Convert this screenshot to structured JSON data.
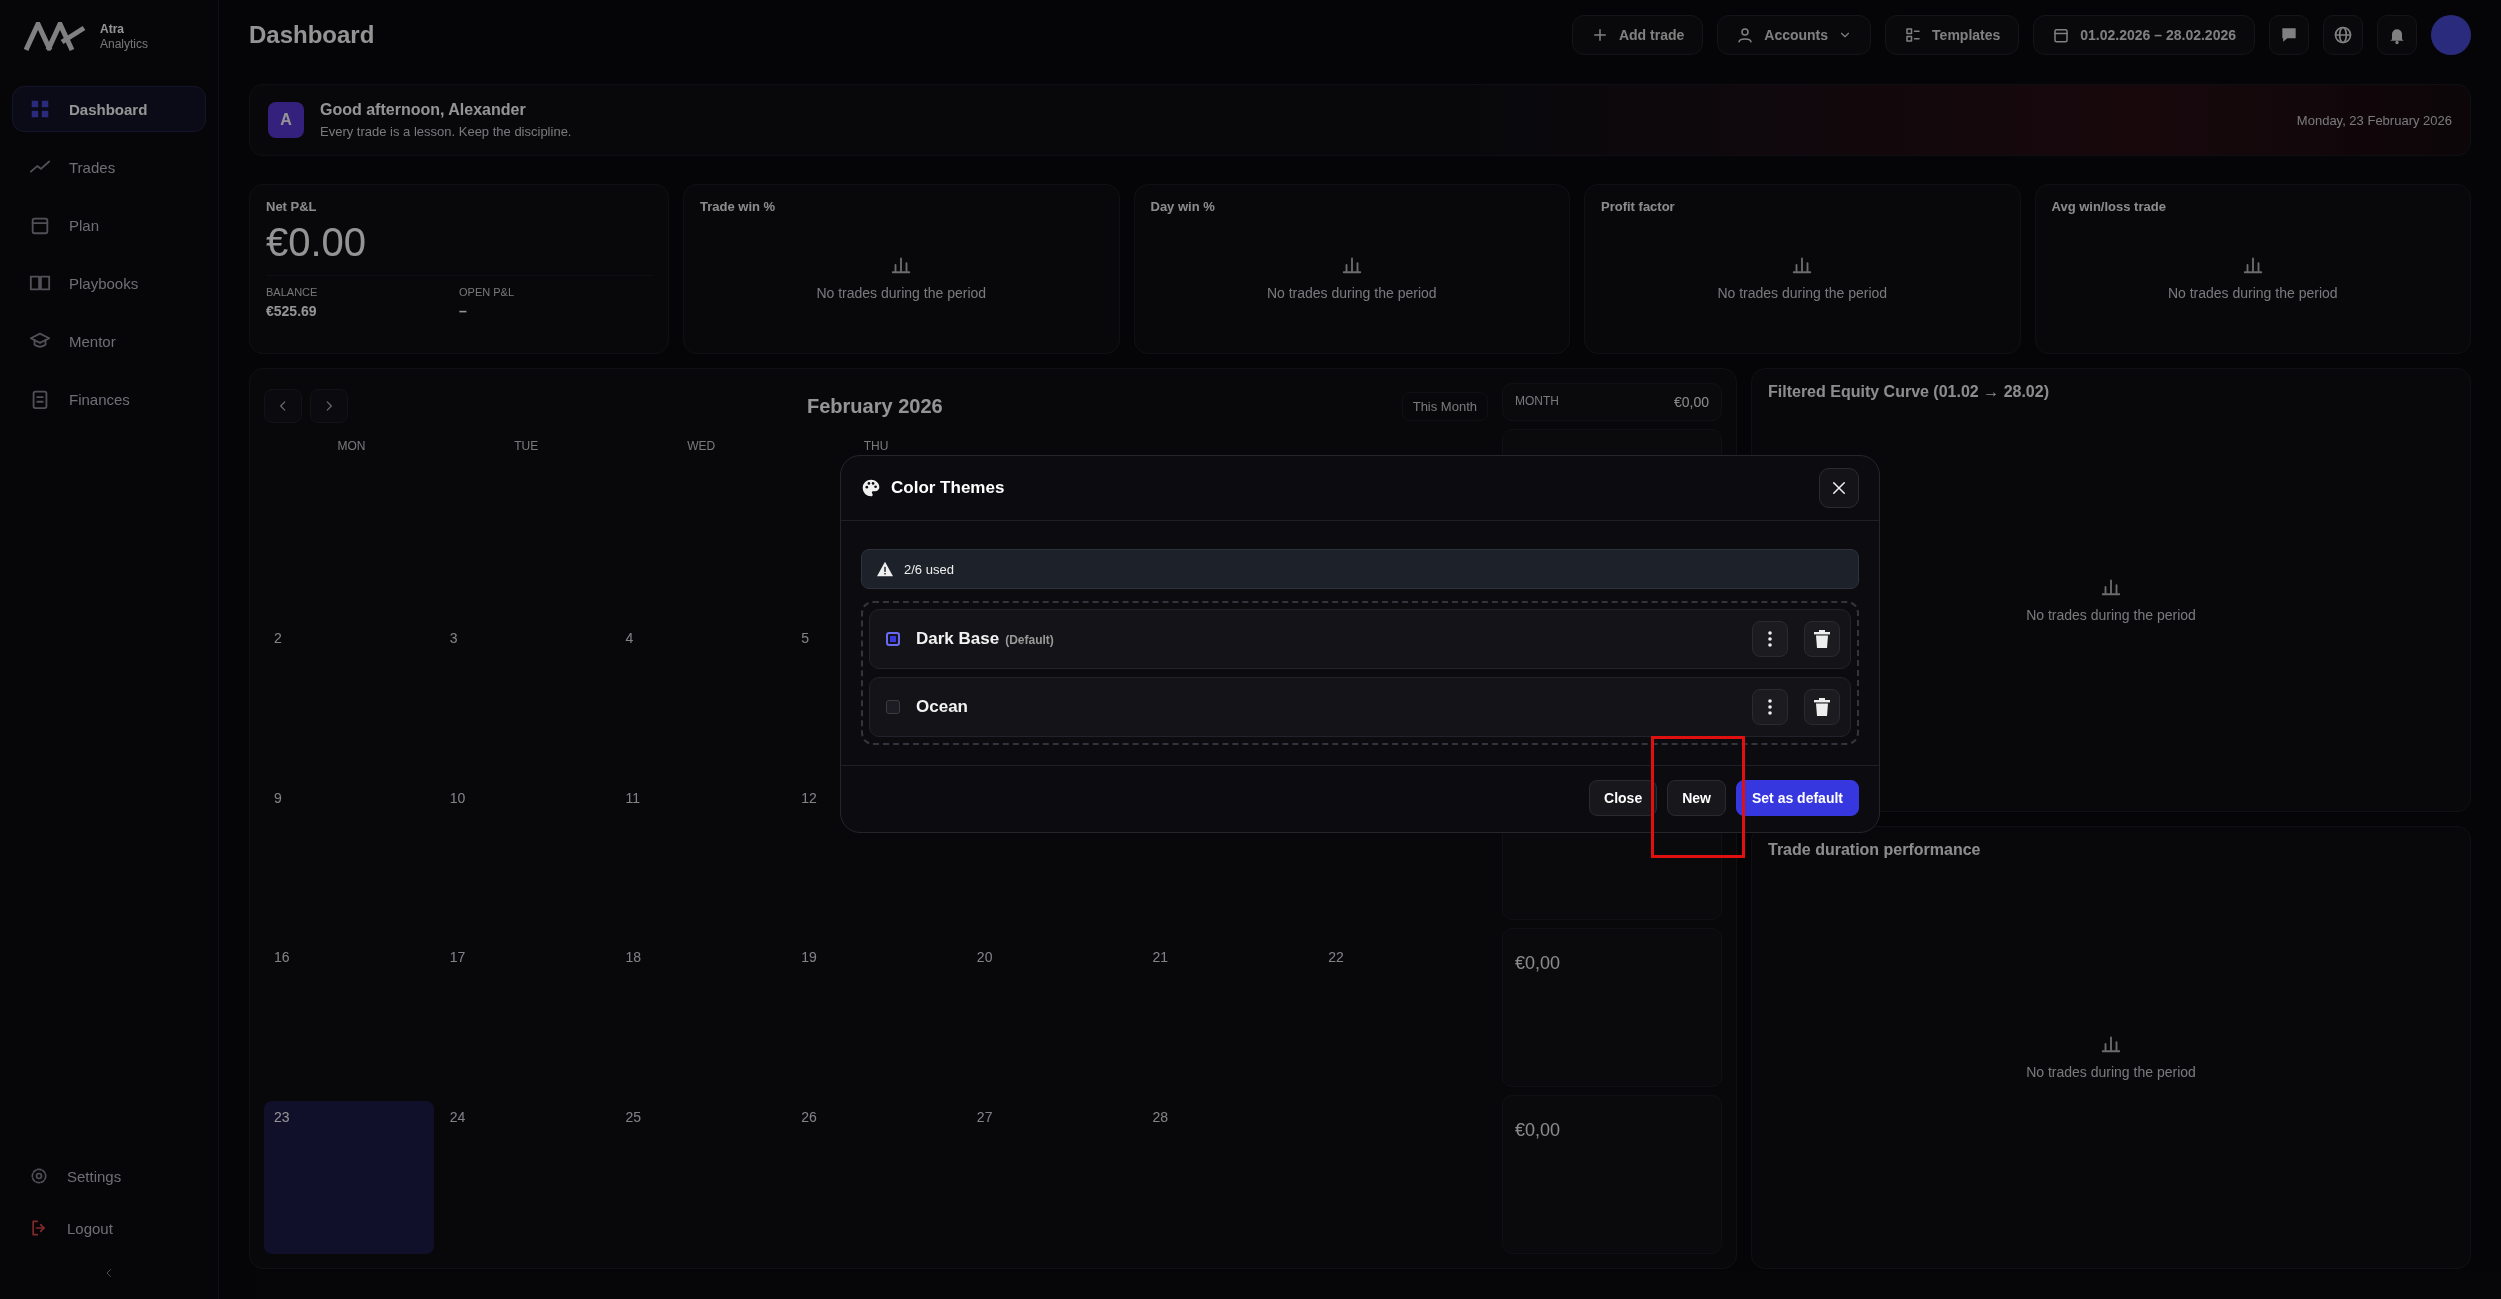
{
  "sidebar": {
    "brand": {
      "name": "Atra",
      "subtitle": "Analytics"
    },
    "items": [
      {
        "kind": "dashboard",
        "label": "Dashboard",
        "selected": true
      },
      {
        "kind": "trades",
        "label": "Trades",
        "selected": false
      },
      {
        "kind": "plan",
        "label": "Plan",
        "selected": false
      },
      {
        "kind": "playbooks",
        "label": "Playbooks",
        "selected": false
      },
      {
        "kind": "mentor",
        "label": "Mentor",
        "selected": false
      },
      {
        "kind": "finances",
        "label": "Finances",
        "selected": false
      }
    ],
    "bottom_items": [
      {
        "kind": "settings",
        "label": "Settings"
      },
      {
        "kind": "logout",
        "label": "Logout"
      }
    ]
  },
  "header": {
    "title": "Dashboard",
    "actions": [
      {
        "kind": "add",
        "label": "Add trade"
      },
      {
        "kind": "accounts",
        "label": "Accounts"
      },
      {
        "kind": "templates",
        "label": "Templates"
      },
      {
        "kind": "date",
        "label": "01.02.2026 – 28.02.2026"
      }
    ],
    "icon_buttons": [
      {
        "kind": "chat"
      },
      {
        "kind": "globe"
      },
      {
        "kind": "bell"
      }
    ]
  },
  "greeting": {
    "initial": "A",
    "title": "Good afternoon, Alexander",
    "subtitle": "Every trade is a lesson. Keep the discipline.",
    "date": "Monday, 23 February 2026"
  },
  "kpis": [
    {
      "kind": "pnl",
      "title": "Net P&L",
      "value": "€0.00",
      "balance_label": "BALANCE",
      "balance": "€525.69",
      "open_label": "OPEN P&L",
      "open": "–"
    },
    {
      "kind": "empty",
      "title": "Trade win %",
      "message": "No trades during the period"
    },
    {
      "kind": "empty",
      "title": "Day win %",
      "message": "No trades during the period"
    },
    {
      "kind": "empty",
      "title": "Profit factor",
      "message": "No trades during the period"
    },
    {
      "kind": "empty",
      "title": "Avg win/loss trade",
      "message": "No trades during the period"
    }
  ],
  "calendar": {
    "title": "February 2026",
    "range_button": "This Month",
    "weekdays": [
      "MON",
      "TUE",
      "WED",
      "THU"
    ],
    "weeks": [
      [
        {
          "day": "2",
          "today": false
        },
        {
          "day": "3",
          "today": false
        },
        {
          "day": "4",
          "today": false
        },
        {
          "day": "5",
          "today": false
        }
      ],
      [
        {
          "day": "9",
          "today": false
        },
        {
          "day": "10",
          "today": false
        },
        {
          "day": "11",
          "today": false
        },
        {
          "day": "12",
          "today": false
        }
      ],
      [
        {
          "day": "16",
          "today": false
        },
        {
          "day": "17",
          "today": false
        },
        {
          "day": "18",
          "today": false
        },
        {
          "day": "19",
          "today": false
        },
        {
          "day": "20",
          "today": false
        },
        {
          "day": "21",
          "today": false
        },
        {
          "day": "22",
          "today": false
        }
      ],
      [
        {
          "day": "23",
          "today": true
        },
        {
          "day": "24",
          "today": false
        },
        {
          "day": "25",
          "today": false
        },
        {
          "day": "26",
          "today": false
        },
        {
          "day": "27",
          "today": false
        },
        {
          "day": "28",
          "today": false
        }
      ]
    ],
    "month_summary": {
      "label": "MONTH",
      "value": "€0,00"
    },
    "week_summaries": [
      {
        "value": "€0,00"
      },
      {
        "value": "€0,00"
      }
    ]
  },
  "panels": [
    {
      "title": "Filtered Equity Curve (01.02 → 28.02)",
      "message": "No trades during the period"
    },
    {
      "title": "Trade duration performance",
      "message": "No trades during the period"
    }
  ],
  "modal": {
    "title": "Color Themes",
    "usage": "2/6 used",
    "themes": [
      {
        "name": "Dark Base",
        "tag": "(Default)",
        "checked": true
      },
      {
        "name": "Ocean",
        "checked": false
      }
    ],
    "buttons": [
      {
        "kind": "secondary",
        "label": "Close"
      },
      {
        "kind": "secondary",
        "label": "New"
      },
      {
        "kind": "primary",
        "label": "Set as default"
      }
    ]
  },
  "annotations": [
    {
      "kind": "box",
      "color": "#e01010"
    }
  ]
}
